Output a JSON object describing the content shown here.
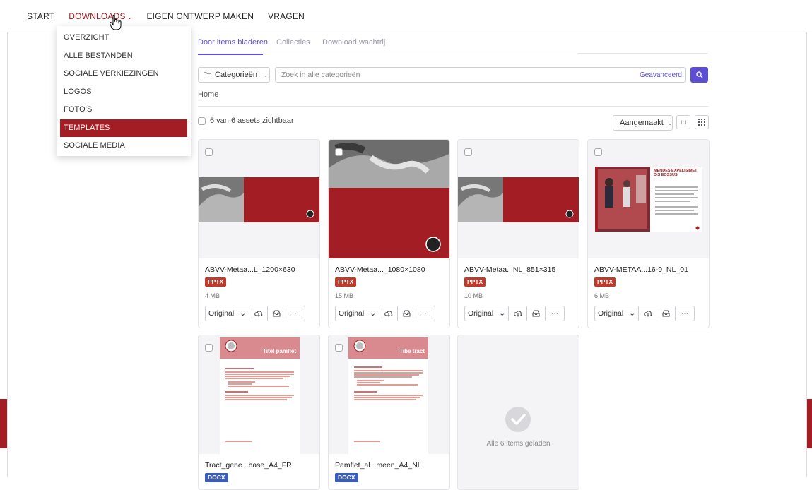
{
  "nav": {
    "items": [
      {
        "label": "START"
      },
      {
        "label": "DOWNLOADS"
      },
      {
        "label": "EIGEN ONTWERP MAKEN"
      },
      {
        "label": "VRAGEN"
      }
    ]
  },
  "dropdown": {
    "items": [
      {
        "label": "OVERZICHT"
      },
      {
        "label": "ALLE BESTANDEN"
      },
      {
        "label": "SOCIALE VERKIEZINGEN"
      },
      {
        "label": "LOGOS"
      },
      {
        "label": "FOTO'S"
      },
      {
        "label": "TEMPLATES"
      },
      {
        "label": "SOCIALE MEDIA"
      }
    ],
    "active_index": 5
  },
  "tabs": [
    {
      "label": "Door items bladeren"
    },
    {
      "label": "Collecties"
    },
    {
      "label": "Download wachtrij"
    }
  ],
  "filter": {
    "category_label": "Categorieën",
    "search_placeholder": "Zoek in alle categorieën",
    "advanced_label": "Geavanceerd"
  },
  "breadcrumb": "Home",
  "count_text": "6 van 6 assets zichtbaar",
  "sort_label": "Aangemaakt",
  "assets": [
    {
      "name": "ABVV-Metaa...L_1200×630",
      "type": "PPTX",
      "size": "4 MB",
      "option": "Original"
    },
    {
      "name": "ABVV-Metaa..._1080×1080",
      "type": "PPTX",
      "size": "15 MB",
      "option": "Original"
    },
    {
      "name": "ABVV-Metaa...NL_851×315",
      "type": "PPTX",
      "size": "10 MB",
      "option": "Original"
    },
    {
      "name": "ABVV-METAA...16-9_NL_01",
      "type": "PPTX",
      "size": "6 MB",
      "option": "Original"
    },
    {
      "name": "Tract_gene...base_A4_FR",
      "type": "DOCX",
      "size": "",
      "option": ""
    },
    {
      "name": "Pamflet_al...meen_A4_NL",
      "type": "DOCX",
      "size": "",
      "option": ""
    }
  ],
  "thumb_texts": {
    "card4_headline": "MENDES EXPELISIMET DIS EOSSUS",
    "card5_title": "Titel pamflet",
    "card6_title": "Tibe tract"
  },
  "loaded_text": "Alle 6 items geladen",
  "colors": {
    "brand_red": "#a31d24",
    "accent_purple": "#5c4fd6",
    "badge_red": "#c0392b",
    "badge_blue": "#3b5bbf"
  }
}
